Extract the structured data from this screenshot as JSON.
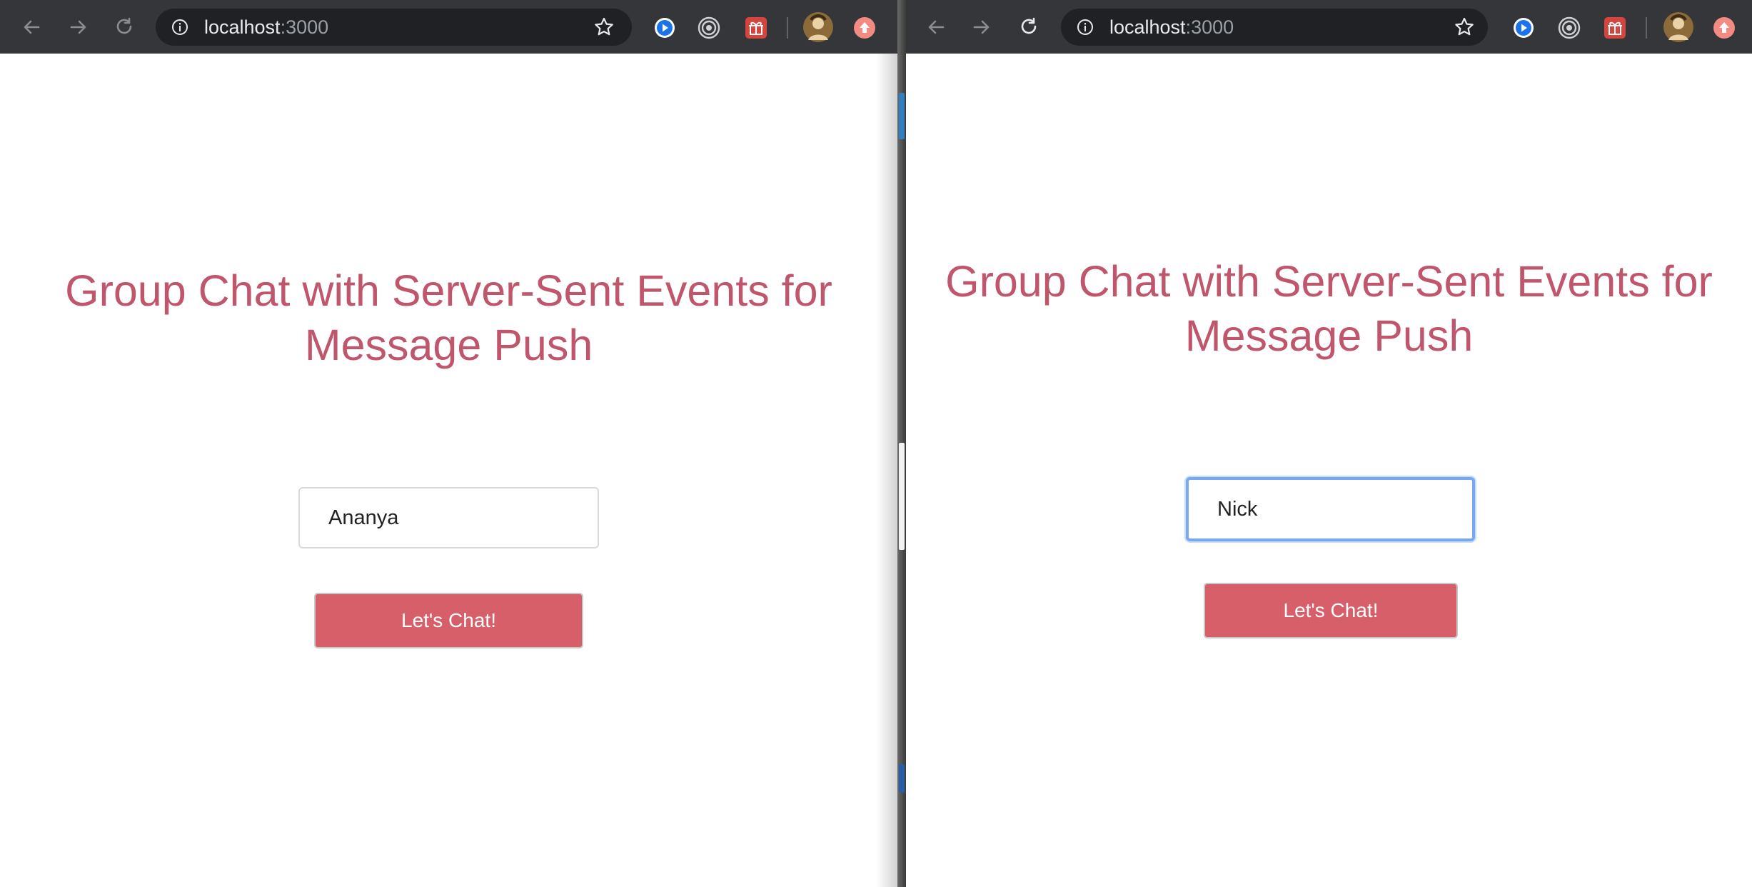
{
  "windows": {
    "left": {
      "address_bar": {
        "host": "localhost",
        "port": ":3000"
      },
      "page": {
        "title": "Group Chat with Server-Sent Events for Message Push",
        "name_input": {
          "value": "Ananya",
          "focused": false
        },
        "submit_label": "Let's Chat!"
      }
    },
    "right": {
      "address_bar": {
        "host": "localhost",
        "port": ":3000"
      },
      "page": {
        "title": "Group Chat with Server-Sent Events for Message Push",
        "name_input": {
          "value": "Nick",
          "focused": true
        },
        "submit_label": "Let's Chat!"
      }
    }
  },
  "toolbar_icons": [
    "back-arrow-icon",
    "forward-arrow-icon",
    "reload-icon",
    "info-icon",
    "bookmark-star-icon",
    "media-play-extension-icon",
    "target-extension-icon",
    "gift-extension-icon",
    "profile-avatar",
    "update-icon"
  ],
  "colors": {
    "title": "#c0566b",
    "button": "#d65f6a",
    "toolbar": "#35363a",
    "omnibox": "#202124",
    "focus_ring": "#77a8f0"
  }
}
